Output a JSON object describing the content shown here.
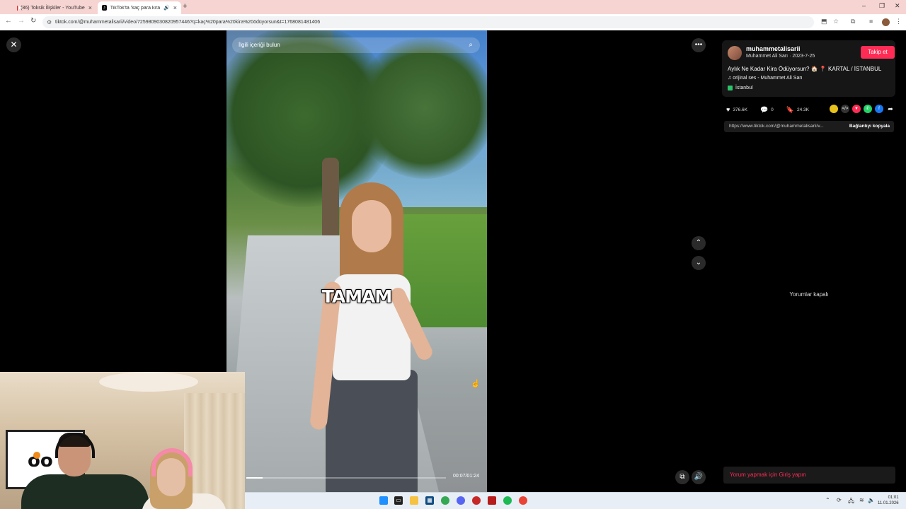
{
  "browser": {
    "tabs": [
      {
        "title": "(86) Toksik İlişkiler - YouTube",
        "active": false
      },
      {
        "title": "TikTok'ta 'kaç para kira ödü",
        "active": true
      }
    ],
    "url": "tiktok.com/@muhammetalisarii/video/7259809030820957446?q=kaç%20para%20kira%20ödüyorsun&t=1768081481406"
  },
  "video": {
    "search_placeholder": "İlgili içeriği bulun",
    "caption": "TAMAM",
    "timecode": "00:07/01:24",
    "progress": 0.083
  },
  "post": {
    "username": "muhammetalisarii",
    "display_name_date": "Muhammet Ali Sarı · 2023-7-25",
    "follow_label": "Takip et",
    "description": "Aylık Ne Kadar Kira Ödüyorsun? 🏠 📍 KARTAL / İSTANBUL",
    "music": "orijinal ses - Muhammet Ali Sarı",
    "location": "İstanbul",
    "likes": "376.6K",
    "comments": "0",
    "saves": "24.3K",
    "link": "https://www.tiktok.com/@muhammetalisarii/v...",
    "copy_label": "Bağlantıyı kopyala",
    "comments_off": "Yorumlar kapalı",
    "login_prompt": "Yorum yapmak için Giriş yapın"
  },
  "taskbar": {
    "time": "01:01",
    "date": "11.01.2026"
  },
  "colors": {
    "accent": "#fe2c55",
    "tabbar": "#f6d4d2"
  }
}
